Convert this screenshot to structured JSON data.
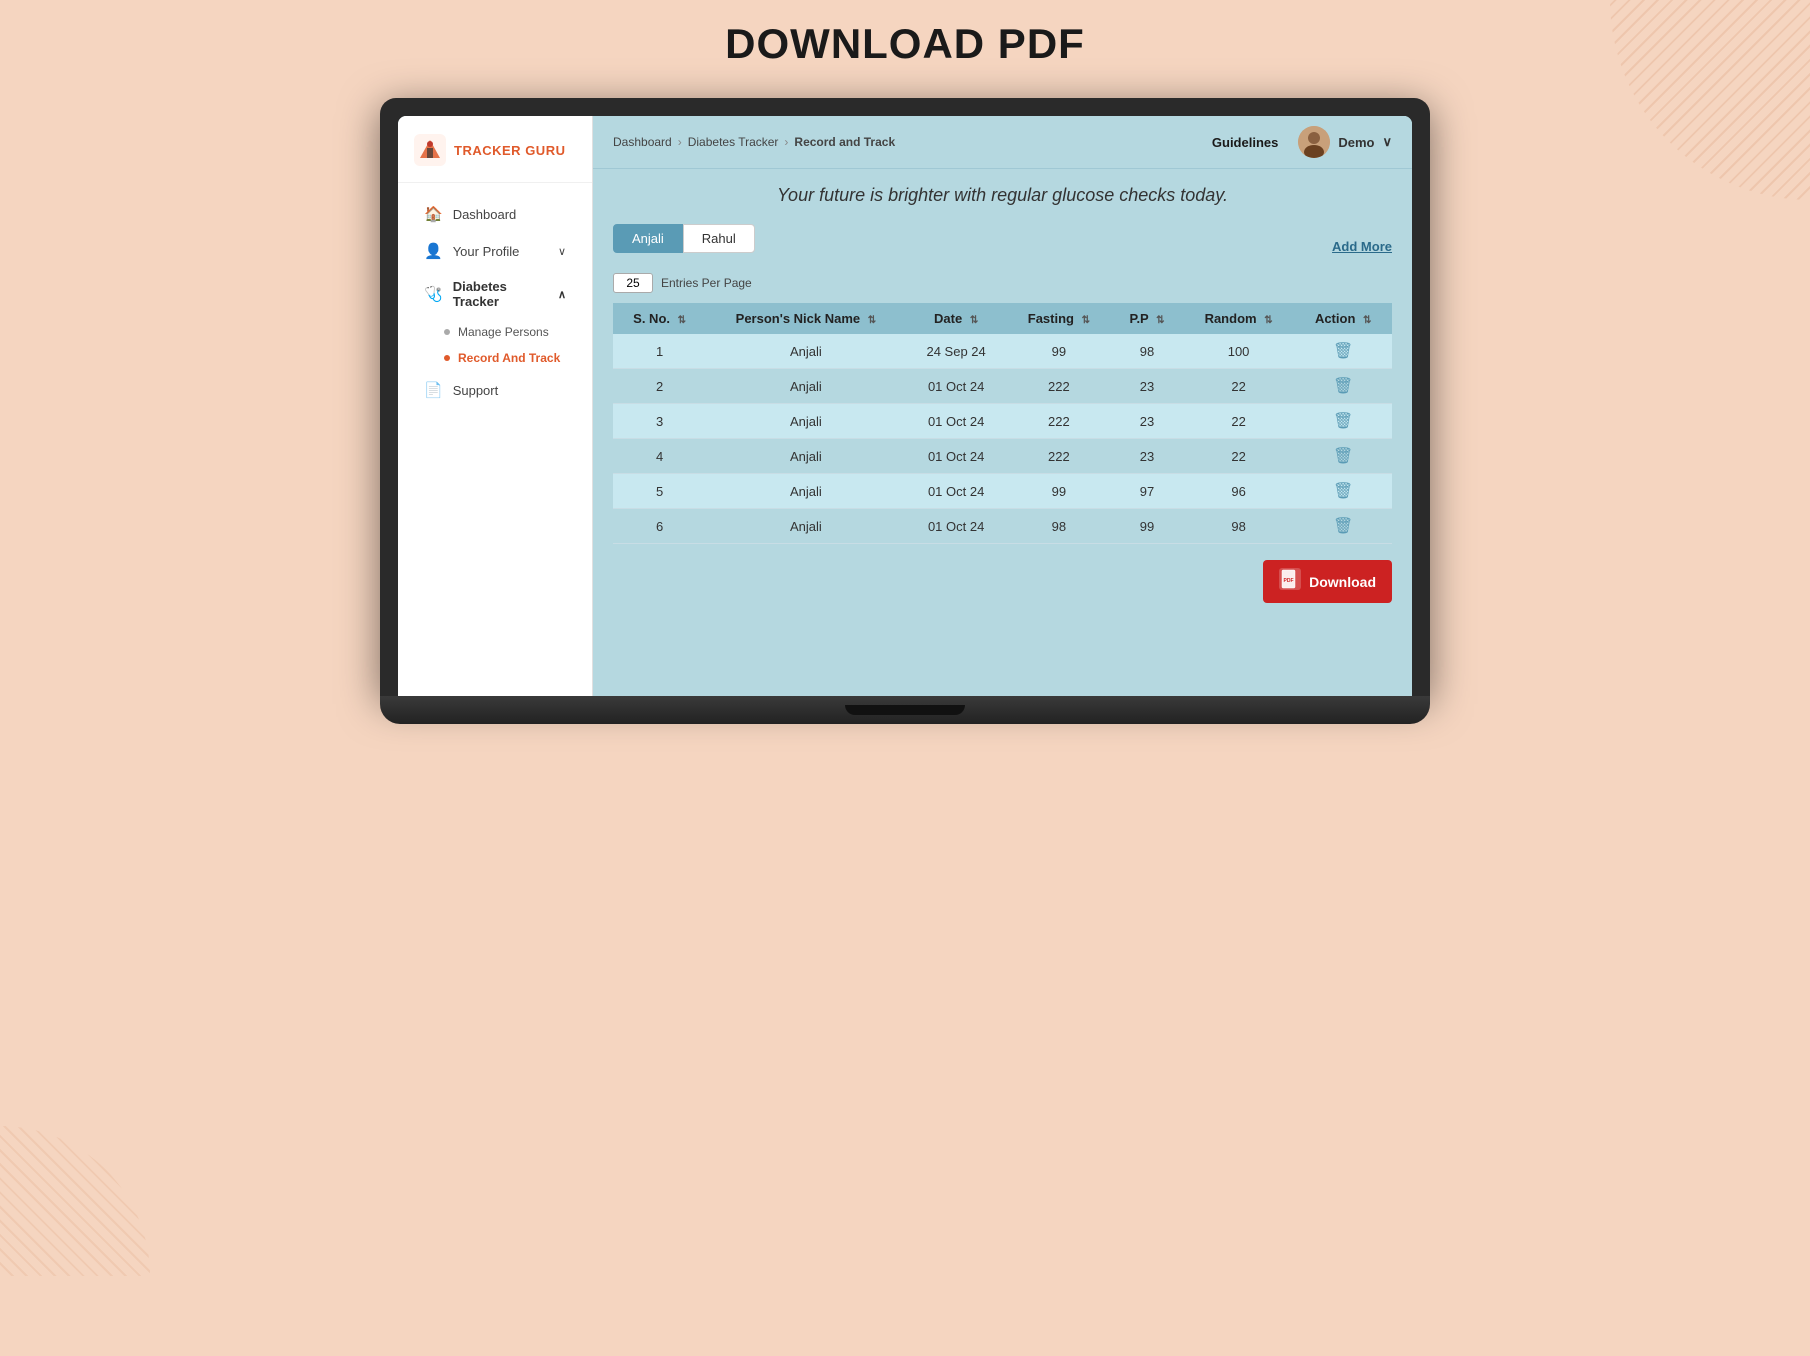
{
  "page": {
    "title": "DOWNLOAD PDF"
  },
  "app": {
    "logo_text_1": "TRACKER",
    "logo_text_2": "GURU"
  },
  "sidebar": {
    "collapse_label": "‹",
    "nav_items": [
      {
        "id": "dashboard",
        "label": "Dashboard",
        "icon": "🏠",
        "active": false
      },
      {
        "id": "your-profile",
        "label": "Your Profile",
        "icon": "👤",
        "active": false,
        "has_submenu": false
      },
      {
        "id": "diabetes-tracker",
        "label": "Diabetes Tracker",
        "icon": "🩺",
        "active": true,
        "has_submenu": true
      }
    ],
    "submenu_items": [
      {
        "id": "manage-persons",
        "label": "Manage Persons",
        "active": false
      },
      {
        "id": "record-and-track",
        "label": "Record And Track",
        "active": true
      }
    ],
    "support": {
      "label": "Support",
      "icon": "📄"
    }
  },
  "header": {
    "breadcrumb": [
      {
        "label": "Dashboard",
        "active": false
      },
      {
        "label": "Diabetes Tracker",
        "active": false
      },
      {
        "label": "Record and Track",
        "active": true
      }
    ],
    "guidelines_label": "Guidelines",
    "user": {
      "name": "Demo",
      "avatar_emoji": "👤"
    }
  },
  "main": {
    "motivational_text": "Your future is brighter with regular glucose checks today.",
    "add_more_label": "Add More",
    "tabs": [
      {
        "label": "Anjali",
        "active": true
      },
      {
        "label": "Rahul",
        "active": false
      }
    ],
    "entries_per_page": {
      "count": "25",
      "label": "Entries Per Page"
    },
    "table": {
      "columns": [
        {
          "key": "sno",
          "label": "S. No.",
          "sortable": true
        },
        {
          "key": "nick_name",
          "label": "Person's Nick Name",
          "sortable": true
        },
        {
          "key": "date",
          "label": "Date",
          "sortable": true
        },
        {
          "key": "fasting",
          "label": "Fasting",
          "sortable": true
        },
        {
          "key": "pp",
          "label": "P.P",
          "sortable": true
        },
        {
          "key": "random",
          "label": "Random",
          "sortable": true
        },
        {
          "key": "action",
          "label": "Action",
          "sortable": true
        }
      ],
      "rows": [
        {
          "sno": 1,
          "nick_name": "Anjali",
          "date": "24 Sep 24",
          "fasting": 99,
          "pp": 98,
          "random": 100
        },
        {
          "sno": 2,
          "nick_name": "Anjali",
          "date": "01 Oct 24",
          "fasting": 222,
          "pp": 23,
          "random": 22
        },
        {
          "sno": 3,
          "nick_name": "Anjali",
          "date": "01 Oct 24",
          "fasting": 222,
          "pp": 23,
          "random": 22
        },
        {
          "sno": 4,
          "nick_name": "Anjali",
          "date": "01 Oct 24",
          "fasting": 222,
          "pp": 23,
          "random": 22
        },
        {
          "sno": 5,
          "nick_name": "Anjali",
          "date": "01 Oct 24",
          "fasting": 99,
          "pp": 97,
          "random": 96
        },
        {
          "sno": 6,
          "nick_name": "Anjali",
          "date": "01 Oct 24",
          "fasting": 98,
          "pp": 99,
          "random": 98
        }
      ]
    },
    "download_label": "Download"
  }
}
